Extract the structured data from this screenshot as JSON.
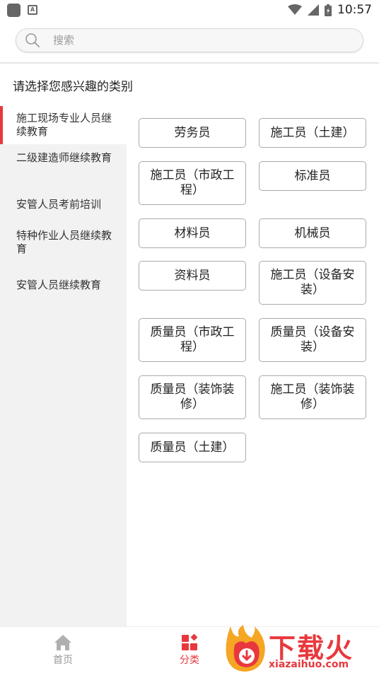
{
  "status_bar": {
    "time": "10:57"
  },
  "search": {
    "placeholder": "搜索"
  },
  "header": {
    "title": "请选择您感兴趣的类别"
  },
  "sidebar": {
    "items": [
      {
        "label": "施工现场专业人员继续教育",
        "active": true
      },
      {
        "label": "二级建造师继续教育",
        "active": false
      },
      {
        "label": "安管人员考前培训",
        "active": false
      },
      {
        "label": "特种作业人员继续教育",
        "active": false
      },
      {
        "label": "安管人员继续教育",
        "active": false
      }
    ]
  },
  "categories": [
    "劳务员",
    "施工员（土建）",
    "施工员（市政工程）",
    "标准员",
    "材料员",
    "机械员",
    "资料员",
    "施工员（设备安装）",
    "质量员（市政工程）",
    "质量员（设备安装）",
    "质量员（装饰装修）",
    "施工员（装饰装修）",
    "质量员（土建）"
  ],
  "bottom_nav": {
    "home_label": "首页",
    "category_label": "分类"
  },
  "watermark": {
    "brand": "下载火",
    "url": "xiazaihuo.com"
  },
  "colors": {
    "accent": "#e8383d",
    "sidebar_bg": "#f2f2f2",
    "inactive_nav": "#999999"
  }
}
